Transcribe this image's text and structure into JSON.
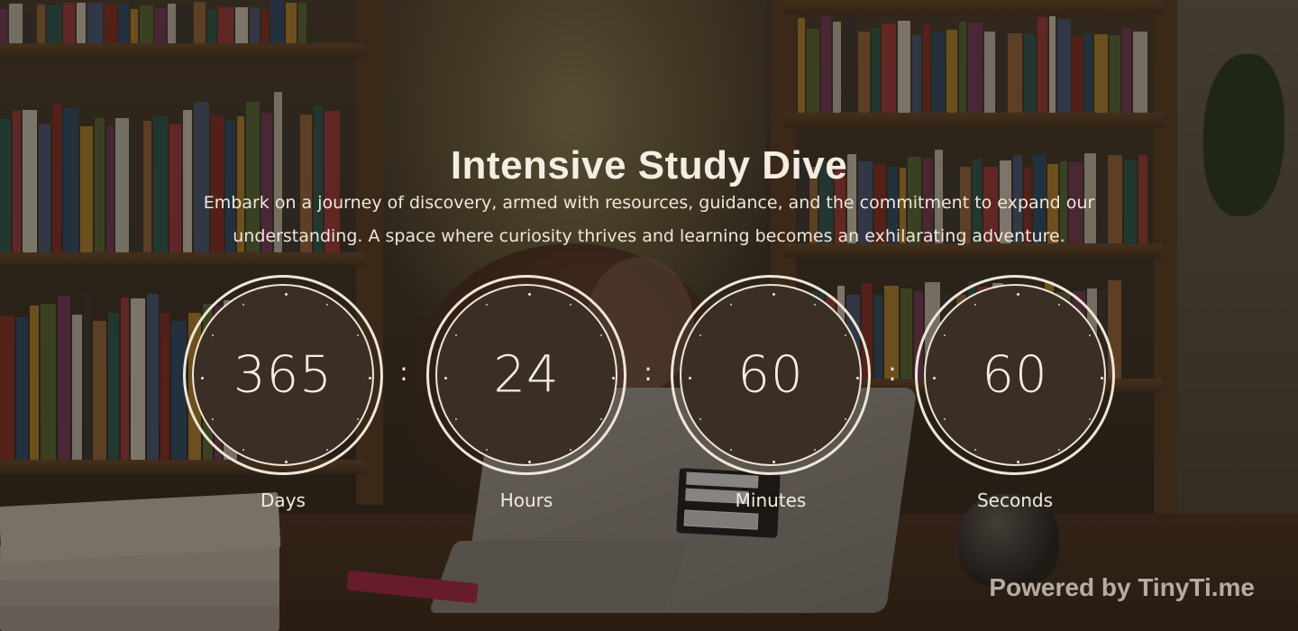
{
  "title": "Intensive Study Dive",
  "description": "Embark on a journey of discovery, armed with resources, guidance, and the commitment to expand our understanding. A space where curiosity thrives and learning becomes an exhilarating adventure.",
  "countdown": {
    "separator": ":",
    "units": [
      {
        "value": "365",
        "label": "Days"
      },
      {
        "value": "24",
        "label": "Hours"
      },
      {
        "value": "60",
        "label": "Minutes"
      },
      {
        "value": "60",
        "label": "Seconds"
      }
    ]
  },
  "branding": {
    "powered_by": "Powered by TinyTi.me"
  },
  "colors": {
    "ring": "#efe6d8",
    "dial_fill": "#3b2e24",
    "text": "#f4ede2"
  }
}
